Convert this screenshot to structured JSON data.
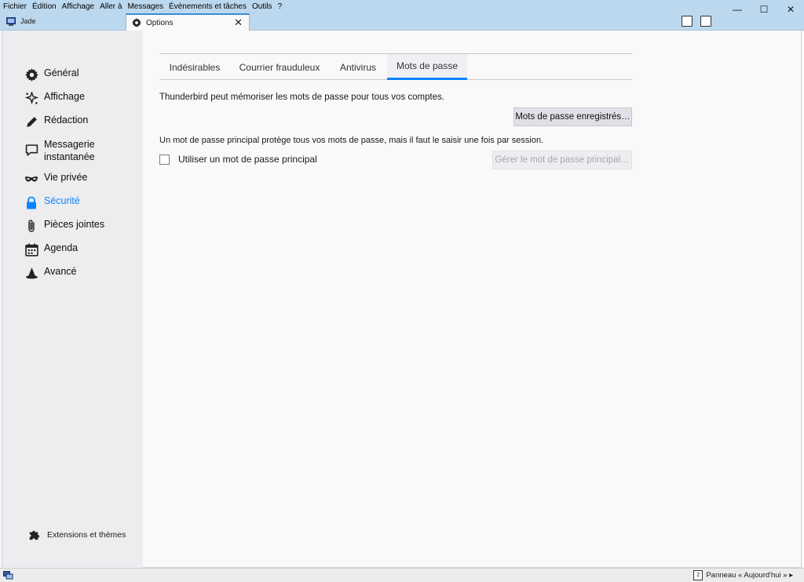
{
  "menu": [
    "Fichier",
    "Édition",
    "Affichage",
    "Aller à",
    "Messages",
    "Évènements et tâches",
    "Outils",
    "?"
  ],
  "window_controls": {
    "minimize": "—",
    "maximize": "☐",
    "close": "✕"
  },
  "tabs_bar": {
    "mail_tab": "Jade",
    "options_tab": "Options",
    "close_glyph": "✕"
  },
  "sidebar": {
    "items": [
      {
        "label": "Général",
        "icon": "gear-icon"
      },
      {
        "label": "Affichage",
        "icon": "sparkle-icon"
      },
      {
        "label": "Rédaction",
        "icon": "pencil-icon"
      },
      {
        "label": "Messagerie instantanée",
        "icon": "chat-icon"
      },
      {
        "label": "Vie privée",
        "icon": "mask-icon"
      },
      {
        "label": "Sécurité",
        "icon": "lock-icon"
      },
      {
        "label": "Pièces jointes",
        "icon": "paperclip-icon"
      },
      {
        "label": "Agenda",
        "icon": "calendar-icon"
      },
      {
        "label": "Avancé",
        "icon": "wizard-hat-icon"
      }
    ],
    "active": "Sécurité",
    "footer": "Extensions et thèmes"
  },
  "panel_tabs": [
    "Indésirables",
    "Courrier frauduleux",
    "Antivirus",
    "Mots de passe"
  ],
  "selected_panel_tab": "Mots de passe",
  "passwords": {
    "intro": "Thunderbird peut mémoriser les mots de passe pour tous vos comptes.",
    "saved_button": "Mots de passe enregistrés…",
    "master_intro": "Un mot de passe principal protège tous vos mots de passe, mais il faut le saisir une fois par session.",
    "master_checkbox": "Utiliser un mot de passe principal",
    "manage_button": "Gérer le mot de passe principal…"
  },
  "statusbar": {
    "today_pane": "Panneau « Aujourd'hui » ▸",
    "today_day": "2"
  },
  "colors": {
    "accent": "#0a84ff",
    "titlebar": "#bcd8ee"
  }
}
